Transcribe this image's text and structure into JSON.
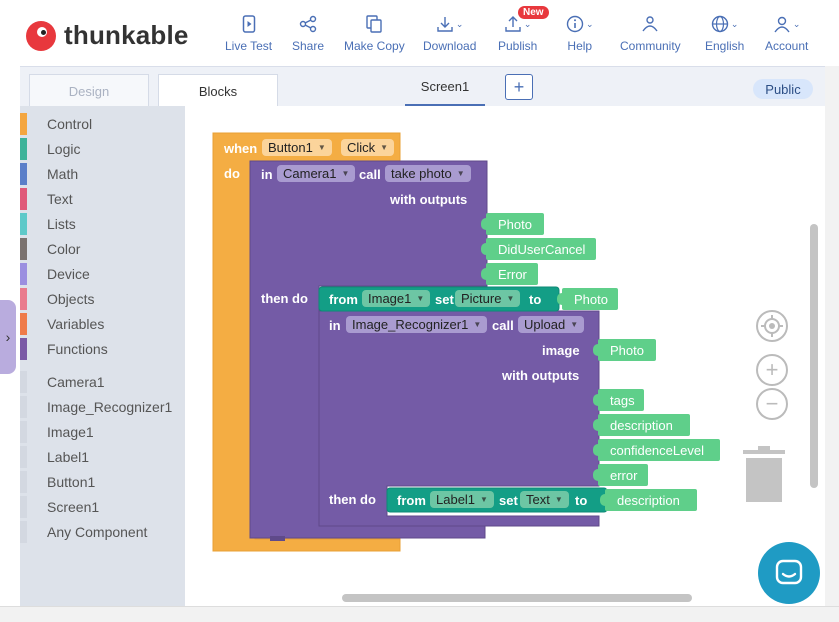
{
  "brand": {
    "name": "thunkable"
  },
  "nav": {
    "live_test": "Live Test",
    "share": "Share",
    "make_copy": "Make Copy",
    "download": "Download",
    "publish": "Publish",
    "publish_badge": "New",
    "help": "Help",
    "community": "Community",
    "language": "English",
    "account": "Account"
  },
  "tabs": {
    "design": "Design",
    "blocks": "Blocks",
    "screen": "Screen1",
    "add": "+",
    "visibility": "Public"
  },
  "toolbox": {
    "categories": [
      {
        "label": "Control",
        "color": "#f4a640"
      },
      {
        "label": "Logic",
        "color": "#3eb39a"
      },
      {
        "label": "Math",
        "color": "#5b7fc9"
      },
      {
        "label": "Text",
        "color": "#e05a7a"
      },
      {
        "label": "Lists",
        "color": "#5ec9c9"
      },
      {
        "label": "Color",
        "color": "#7b7370"
      },
      {
        "label": "Device",
        "color": "#9b8fe0"
      },
      {
        "label": "Objects",
        "color": "#e97b8d"
      },
      {
        "label": "Variables",
        "color": "#ef7b4a"
      },
      {
        "label": "Functions",
        "color": "#7b5aa6"
      }
    ],
    "components": [
      "Camera1",
      "Image_Recognizer1",
      "Image1",
      "Label1",
      "Button1",
      "Screen1",
      "Any Component"
    ]
  },
  "blocks": {
    "event": {
      "when": "when",
      "component": "Button1",
      "event": "Click",
      "do": "do"
    },
    "camera": {
      "in": "in",
      "component": "Camera1",
      "call": "call",
      "method": "take photo",
      "with_outputs": "with outputs",
      "outputs": [
        "Photo",
        "DidUserCancel",
        "Error"
      ],
      "then_do": "then do"
    },
    "set_image": {
      "from": "from",
      "component": "Image1",
      "set": "set",
      "property": "Picture",
      "to": "to",
      "value": "Photo"
    },
    "recognizer": {
      "in": "in",
      "component": "Image_Recognizer1",
      "call": "call",
      "method": "Upload",
      "image_label": "image",
      "image_value": "Photo",
      "with_outputs": "with outputs",
      "outputs": [
        "tags",
        "description",
        "confidenceLevel",
        "error"
      ],
      "then_do": "then do"
    },
    "set_label": {
      "from": "from",
      "component": "Label1",
      "set": "set",
      "property": "Text",
      "to": "to",
      "value": "description"
    }
  }
}
